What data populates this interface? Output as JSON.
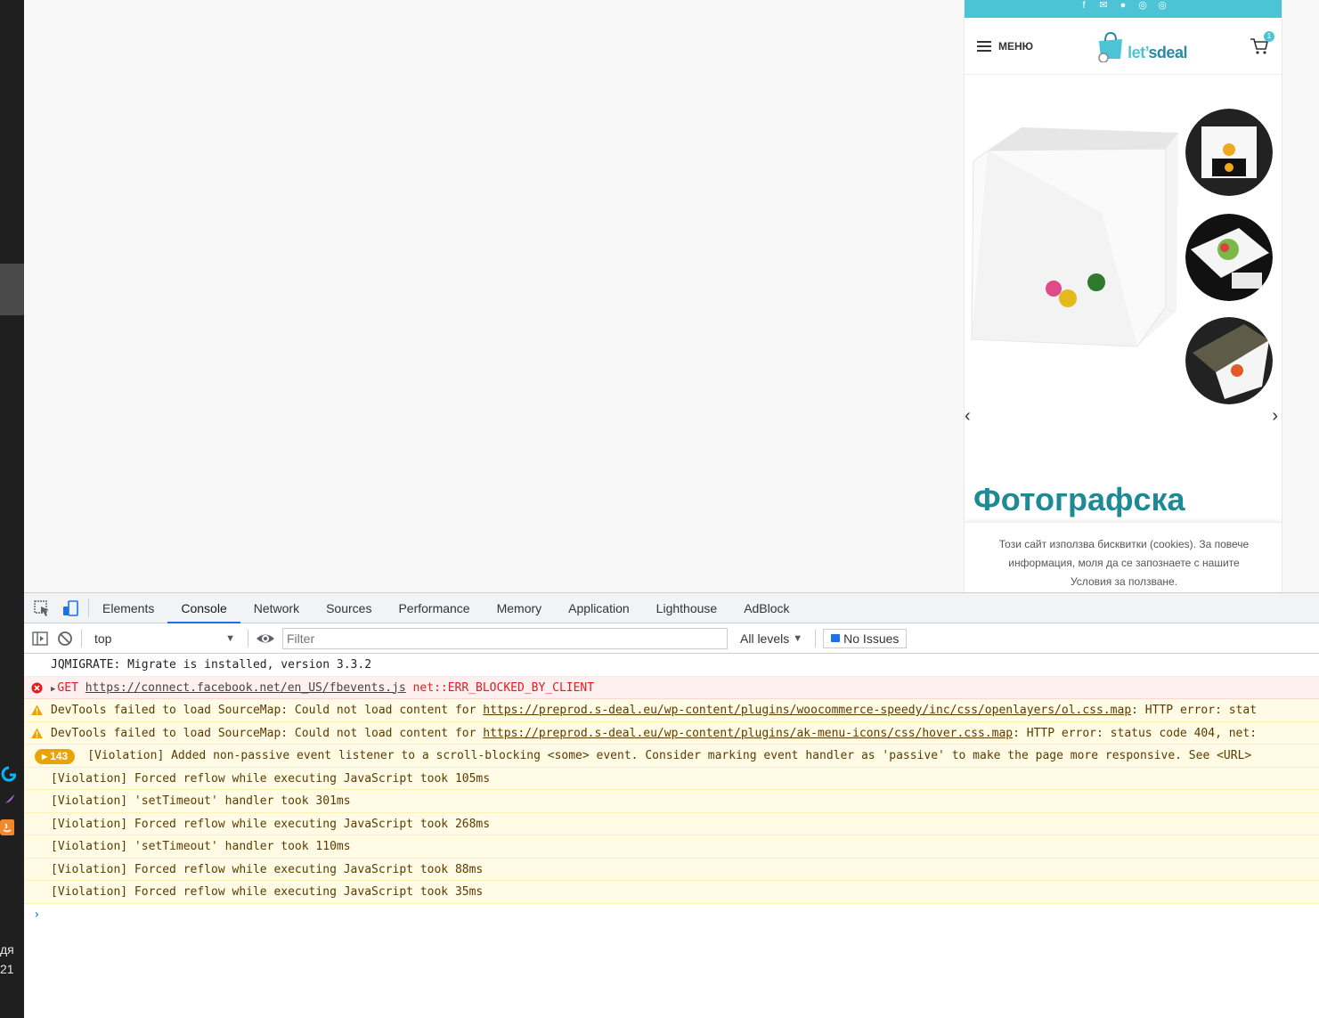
{
  "taskbar": {
    "text_line1": "дя",
    "text_line2": "21"
  },
  "site": {
    "menu_label": "МЕНЮ",
    "logo_text_a": "let’",
    "logo_text_b": "sdeal",
    "cart_count": "1",
    "product_title": "Фотографска",
    "cookie_notice": "Този сайт използва бисквитки (cookies). За повече информация, моля да се запознаете с нашите Условия за ползване.",
    "prev_arrow": "‹",
    "next_arrow": "›"
  },
  "devtools": {
    "tabs": [
      "Elements",
      "Console",
      "Network",
      "Sources",
      "Performance",
      "Memory",
      "Application",
      "Lighthouse",
      "AdBlock"
    ],
    "active_tab": "Console",
    "context": "top",
    "filter_placeholder": "Filter",
    "levels": "All levels",
    "issues": "No Issues",
    "accent_color": "#1a73e8"
  },
  "console": {
    "messages": [
      {
        "level": "info",
        "text": "JQMIGRATE: Migrate is installed, version 3.3.2"
      },
      {
        "level": "error",
        "prefix": "GET ",
        "link": "https://connect.facebook.net/en_US/fbevents.js",
        "suffix": " net::ERR_BLOCKED_BY_CLIENT"
      },
      {
        "level": "warning",
        "prefix": "DevTools failed to load SourceMap: Could not load content for ",
        "link": "https://preprod.s-deal.eu/wp-content/plugins/woocommerce-speedy/inc/css/openlayers/ol.css.map",
        "suffix": ": HTTP error: stat"
      },
      {
        "level": "warning",
        "prefix": "DevTools failed to load SourceMap: Could not load content for ",
        "link": "https://preprod.s-deal.eu/wp-content/plugins/ak-menu-icons/css/hover.css.map",
        "suffix": ": HTTP error: status code 404, net:"
      },
      {
        "level": "violation-group",
        "count": "143",
        "text": "[Violation] Added non-passive event listener to a scroll-blocking <some> event. Consider marking event handler as 'passive' to make the page more responsive. See <URL>"
      },
      {
        "level": "violation",
        "text": "[Violation] Forced reflow while executing JavaScript took 105ms"
      },
      {
        "level": "violation",
        "text": "[Violation] 'setTimeout' handler took 301ms"
      },
      {
        "level": "violation",
        "text": "[Violation] Forced reflow while executing JavaScript took 268ms"
      },
      {
        "level": "violation",
        "text": "[Violation] 'setTimeout' handler took 110ms"
      },
      {
        "level": "violation",
        "text": "[Violation] Forced reflow while executing JavaScript took 88ms"
      },
      {
        "level": "violation",
        "text": "[Violation] Forced reflow while executing JavaScript took 35ms"
      }
    ],
    "prompt_symbol": "›"
  }
}
